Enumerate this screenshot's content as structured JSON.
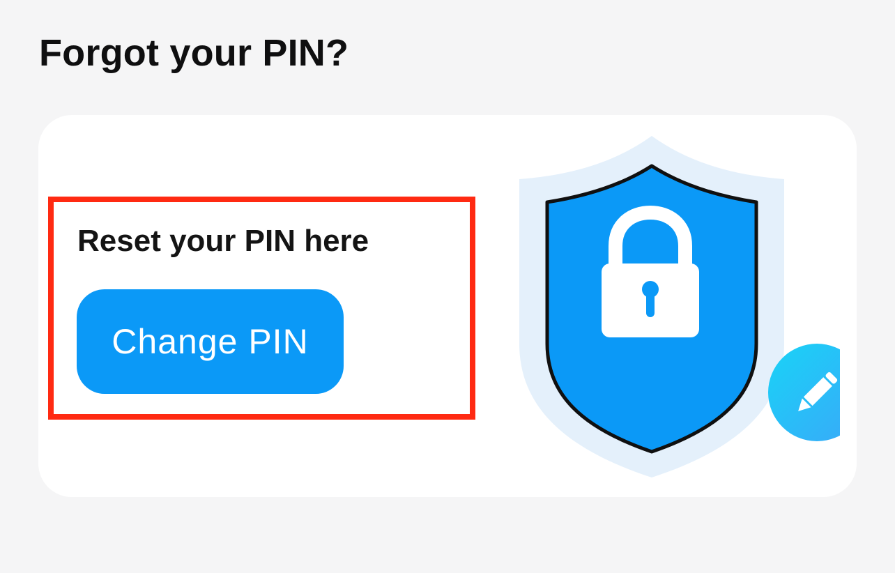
{
  "header": {
    "title": "Forgot your PIN?"
  },
  "reset_card": {
    "label": "Reset your PIN here",
    "button_label": "Change PIN"
  },
  "icons": {
    "shield": "shield-icon",
    "lock": "lock-icon",
    "edit": "pencil-icon"
  },
  "colors": {
    "page_background": "#f5f5f6",
    "card_background": "#ffffff",
    "primary_button": "#0b99f7",
    "highlight_border": "#ff2a12",
    "shield_fill": "#0b99f7",
    "shield_halo": "#e3f0fb",
    "edit_badge": "#1ec8f5"
  }
}
